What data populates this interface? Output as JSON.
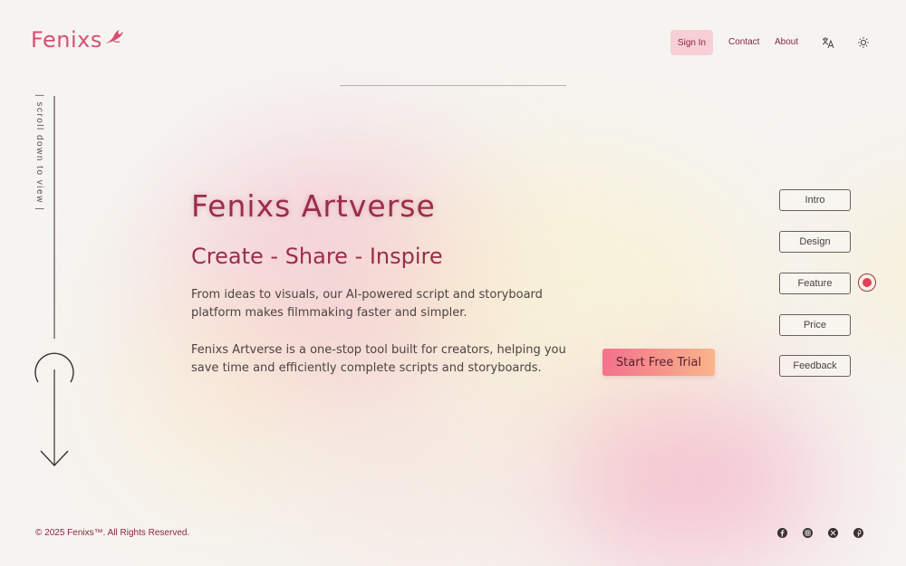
{
  "brand": {
    "name": "Fenixs",
    "logo_icon": "phoenix-bird-icon",
    "color": "#d94f6f"
  },
  "nav": {
    "sign_in": "Sign In",
    "contact": "Contact",
    "about": "About",
    "translate_icon": "translate-icon",
    "theme_icon": "sun-icon"
  },
  "scroll_hint": "| scroll down to view |",
  "hero": {
    "title": "Fenixs Artverse",
    "subtitle": "Create - Share - Inspire",
    "paragraph1": "From ideas to visuals, our AI-powered script and storyboard platform makes filmmaking faster and simpler.",
    "paragraph2": "Fenixs Artverse is a one-stop tool built for creators, helping you save time and efficiently complete scripts and storyboards.",
    "cta": "Start Free Trial"
  },
  "section_nav": {
    "items": [
      "Intro",
      "Design",
      "Feature",
      "Price",
      "Feedback"
    ],
    "active": "Feature"
  },
  "footer": {
    "copyright": "© 2025 Fenixs™. All Rights Reserved.",
    "social_icons": [
      "facebook-icon",
      "instagram-icon",
      "x-icon",
      "pinterest-icon"
    ]
  },
  "colors": {
    "accent": "#9b2d48",
    "nav_pill": "#f7cfd6",
    "cta_start": "#f4718c",
    "cta_end": "#f8b58a"
  }
}
